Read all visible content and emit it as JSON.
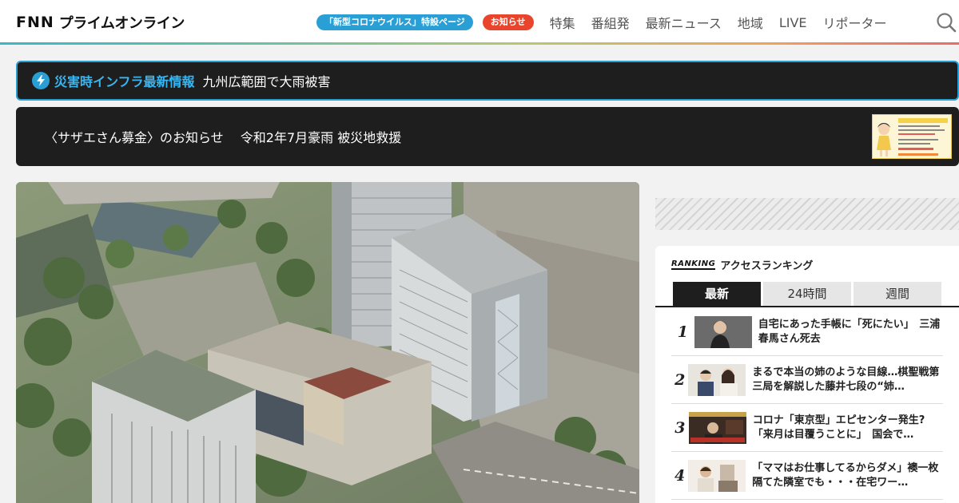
{
  "header": {
    "logo_fnn": "FNN",
    "logo_text": "プライムオンライン",
    "corona_pill": "「新型コロナウイルス」特設ページ",
    "notice_pill": "お知らせ",
    "nav": [
      "特集",
      "番組発",
      "最新ニュース",
      "地域",
      "LIVE",
      "リポーター"
    ]
  },
  "disaster": {
    "label": "災害時インフラ最新情報",
    "text": "九州広範囲で大雨被害"
  },
  "donation": {
    "text": "〈サザエさん募金〉のお知らせ　 令和2年7月豪雨 被災地救援"
  },
  "ranking": {
    "logo": "RANKING",
    "heading": "アクセスランキング",
    "tabs": [
      "最新",
      "24時間",
      "週間"
    ],
    "items": [
      {
        "rank": "1",
        "title": "自宅にあった手帳に「死にたい」　三浦春馬さん死去"
      },
      {
        "rank": "2",
        "title": "まるで本当の姉のような目線…棋聖戦第三局を解説した藤井七段の“姉…"
      },
      {
        "rank": "3",
        "title": "コロナ「東京型」エピセンター発生?「来月は目覆うことに」　国会で…"
      },
      {
        "rank": "4",
        "title": "「ママはお仕事してるからダメ」襖一枚隔てた隣室でも・・・在宅ワー…"
      }
    ]
  },
  "colors": {
    "accent_blue": "#2a9fd6",
    "notice_red": "#e8452c",
    "dark_bg": "#1e1e1e"
  }
}
